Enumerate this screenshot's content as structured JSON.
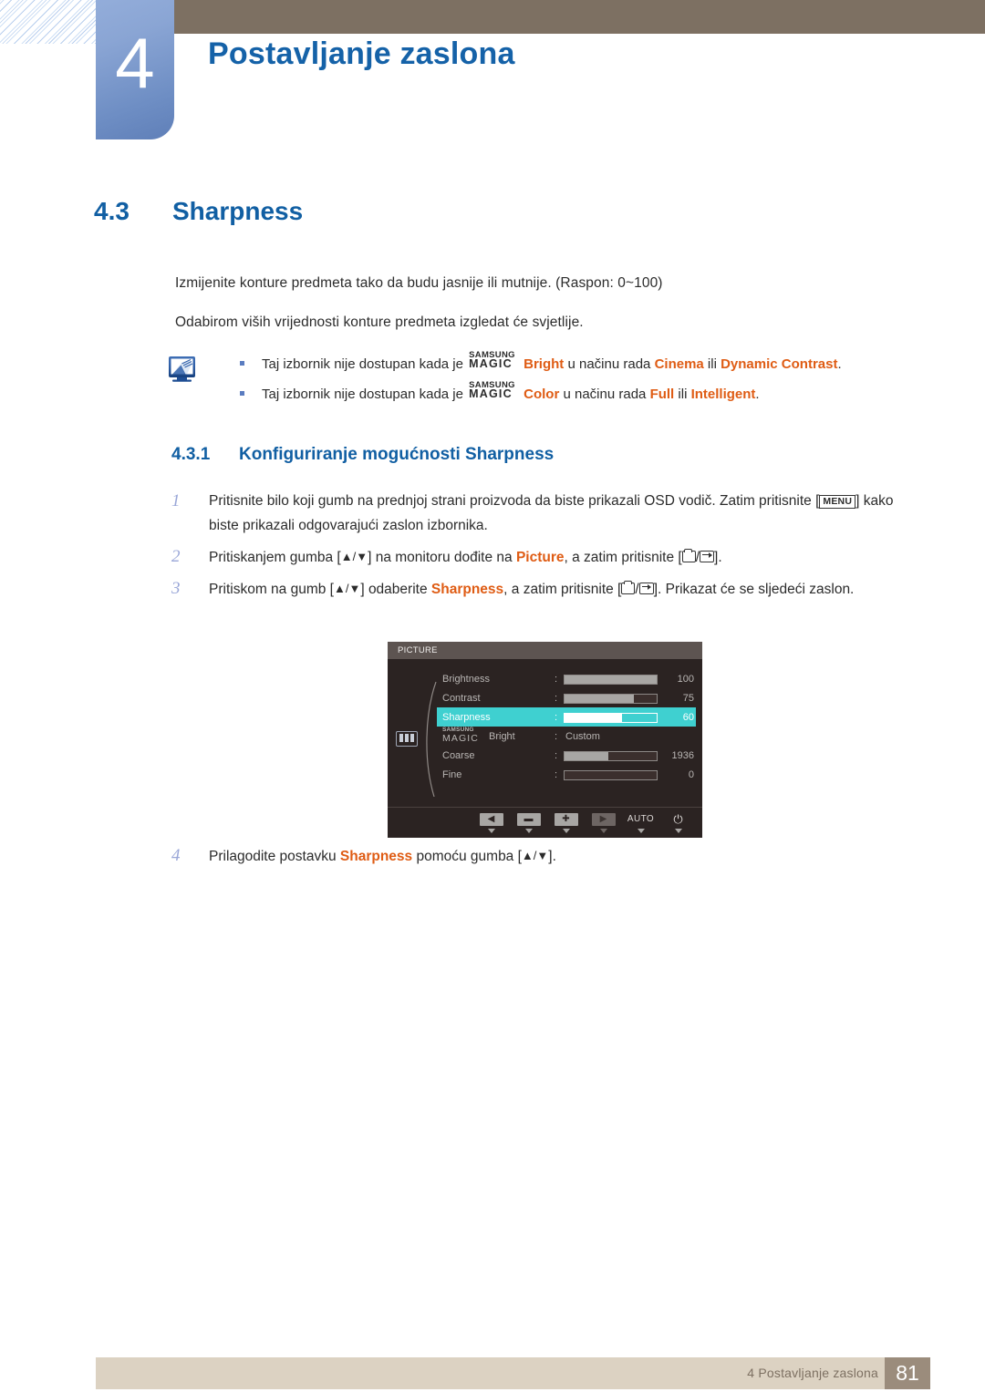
{
  "header": {
    "chapter_number": "4",
    "chapter_title": "Postavljanje zaslona",
    "bar_color": "#7d7062",
    "tab_color": "#7690c7",
    "title_color": "#1562a8"
  },
  "section": {
    "number": "4.3",
    "title": "Sharpness"
  },
  "body": {
    "para1": "Izmijenite konture predmeta tako da budu jasnije ili mutnije. (Raspon: 0~100)",
    "para2": "Odabirom viših vrijednosti konture predmeta izgledat će svjetlije."
  },
  "note": {
    "icon": "monitor-note-icon",
    "items": [
      {
        "prefix": "Taj izbornik nije dostupan kada je ",
        "magic_top": "SAMSUNG",
        "magic_bottom": "MAGIC",
        "magic_suffix": "Bright",
        "mid": " u načinu rada ",
        "term1": "Cinema",
        "conj": " ili ",
        "term2": "Dynamic Contrast",
        "end": "."
      },
      {
        "prefix": "Taj izbornik nije dostupan kada je ",
        "magic_top": "SAMSUNG",
        "magic_bottom": "MAGIC",
        "magic_suffix": "Color",
        "mid": " u načinu rada ",
        "term1": "Full",
        "conj": " ili ",
        "term2": "Intelligent",
        "end": "."
      }
    ]
  },
  "subsection": {
    "number": "4.3.1",
    "title": "Konfiguriranje mogućnosti Sharpness"
  },
  "steps": [
    {
      "index": "1",
      "part1": "Pritisnite bilo koji gumb na prednjoj strani proizvoda da biste prikazali OSD vodič. Zatim pritisnite [",
      "key": "MENU",
      "part2": "] kako biste prikazali odgovarajući zaslon izbornika."
    },
    {
      "index": "2",
      "part1": "Pritiskanjem gumba [",
      "arrows": "▲/▼",
      "part2": "] na monitoru dođite na ",
      "highlight": "Picture",
      "part3": ", a zatim pritisnite [",
      "part4": "]."
    },
    {
      "index": "3",
      "part1": "Pritiskom na gumb [",
      "arrows": "▲/▼",
      "part2": "] odaberite ",
      "highlight": "Sharpness",
      "part3": ", a zatim pritisnite [",
      "part4": "]. Prikazat će se sljedeći zaslon."
    },
    {
      "index": "4",
      "part1": "Prilagodite postavku ",
      "highlight": "Sharpness",
      "part2": " pomoću gumba [",
      "arrows": "▲/▼",
      "part3": "]."
    }
  ],
  "osd": {
    "title": "PICTURE",
    "panel_bg": "#2b2322",
    "title_bg": "#5d5451",
    "highlight_color": "#3fd0d0",
    "menu_icon": "picture-settings-icon",
    "rows": [
      {
        "label": "Brightness",
        "colon": ":",
        "value": "100",
        "fill_percent": 100,
        "type": "bar",
        "selected": false
      },
      {
        "label": "Contrast",
        "colon": ":",
        "value": "75",
        "fill_percent": 75,
        "type": "bar",
        "selected": false
      },
      {
        "label": "Sharpness",
        "colon": ":",
        "value": "60",
        "fill_percent": 62,
        "type": "bar",
        "selected": true
      },
      {
        "label": "Bright",
        "colon": ":",
        "value": "Custom",
        "magic_top": "SAMSUNG",
        "magic_bottom": "MAGIC",
        "type": "text",
        "selected": false
      },
      {
        "label": "Coarse",
        "colon": ":",
        "value": "1936",
        "fill_percent": 48,
        "type": "bar",
        "selected": false
      },
      {
        "label": "Fine",
        "colon": ":",
        "value": "0",
        "fill_percent": 0,
        "type": "bar",
        "selected": false
      }
    ],
    "buttons": [
      {
        "name": "left-arrow-button",
        "glyph": "◀",
        "kind": "box",
        "dim": false
      },
      {
        "name": "minus-button",
        "glyph": "▬",
        "kind": "box",
        "dim": false
      },
      {
        "name": "plus-button",
        "glyph": "✚",
        "kind": "box",
        "dim": false
      },
      {
        "name": "right-arrow-button",
        "glyph": "▶",
        "kind": "box",
        "dim": true
      },
      {
        "name": "auto-button",
        "glyph": "AUTO",
        "kind": "text",
        "dim": false
      },
      {
        "name": "power-button",
        "glyph": "⏻",
        "kind": "power",
        "dim": false
      }
    ]
  },
  "footer": {
    "text": "4 Postavljanje zaslona",
    "page": "81",
    "bar_color": "#dcd2c2",
    "page_box_color": "#9b8c7c"
  }
}
